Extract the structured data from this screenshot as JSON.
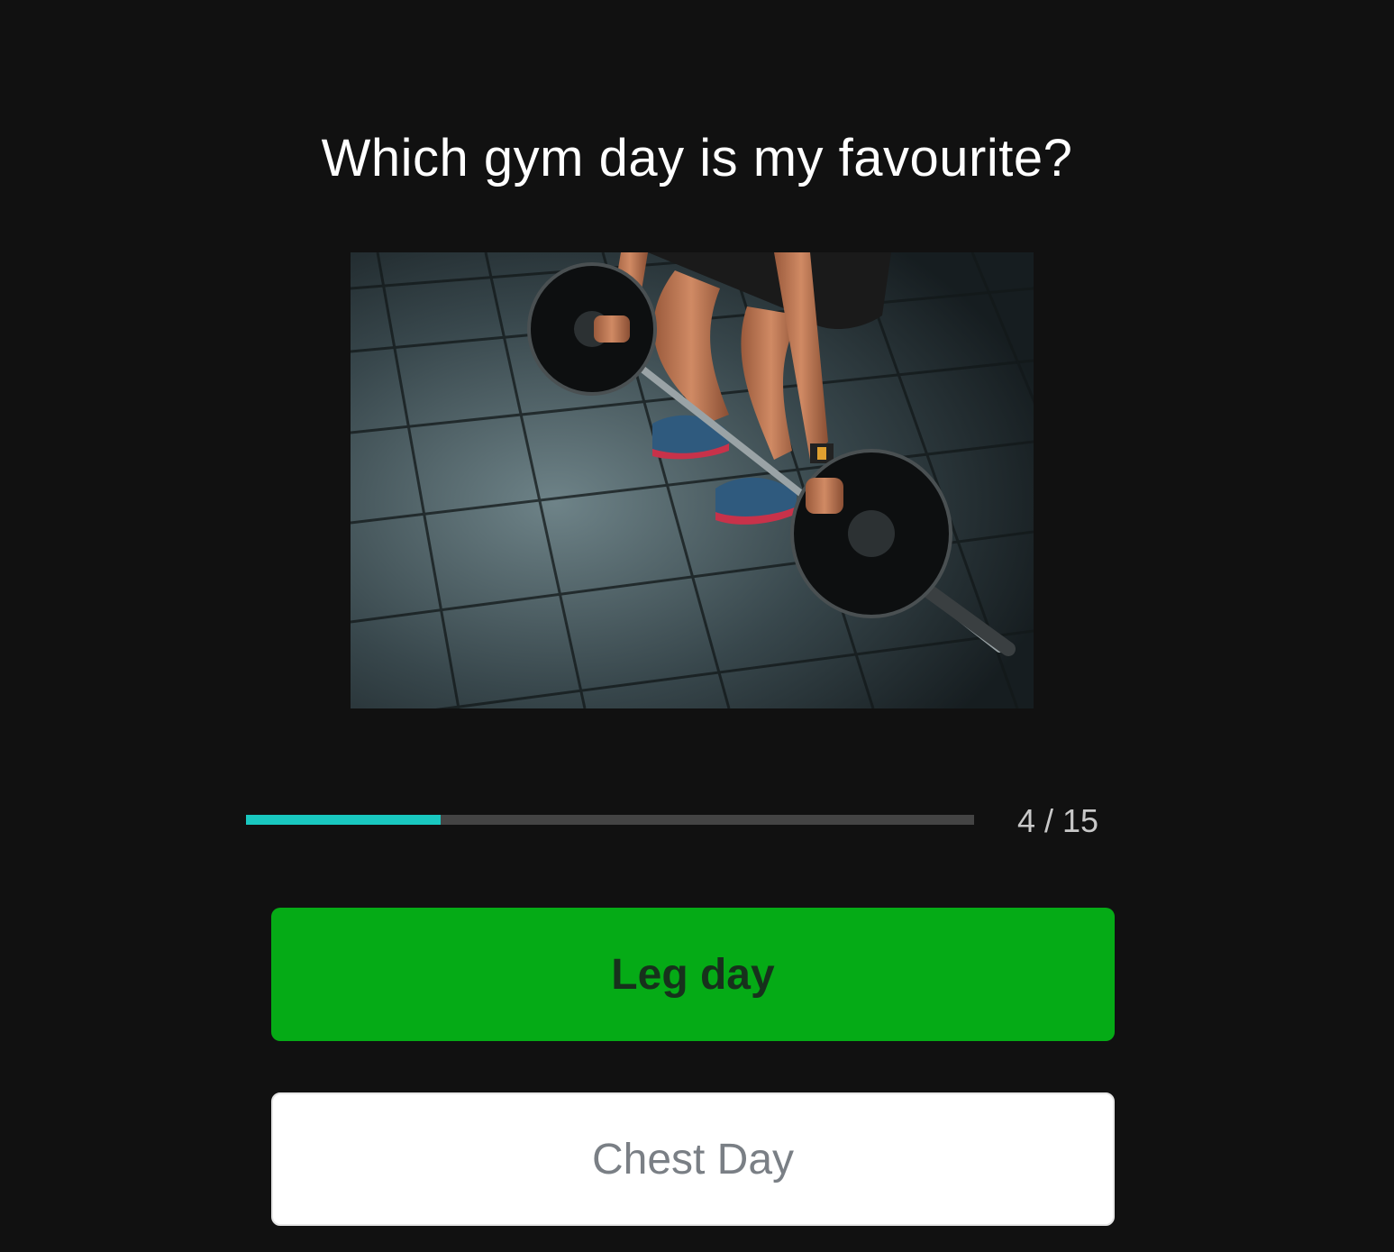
{
  "quiz": {
    "question": "Which gym day is my favourite?",
    "image_alt": "Person lifting a barbell on a dark gym floor",
    "progress": {
      "current": 4,
      "total": 15,
      "label": "4 / 15",
      "fraction": 0.267
    },
    "answers": [
      {
        "label": "Leg day",
        "state": "correct"
      },
      {
        "label": "Chest Day",
        "state": "default"
      }
    ]
  },
  "colors": {
    "background": "#111111",
    "progress_fill": "#19c8c0",
    "progress_track": "#444444",
    "correct_answer": "#05ab16",
    "default_answer": "#ffffff"
  }
}
